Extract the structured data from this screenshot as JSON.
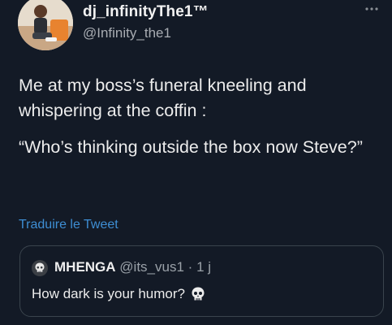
{
  "author": {
    "display_name": "dj_infinityThe1™",
    "handle": "@Infinity_the1"
  },
  "tweet": {
    "paragraphs": [
      "Me at my boss’s funeral kneeling and whispering at the coffin :",
      "“Who’s thinking outside the box now Steve?”"
    ],
    "translate_label": "Traduire le Tweet"
  },
  "quote": {
    "name": "MHENGA",
    "handle": "@its_vus1",
    "separator": "·",
    "time": "1 j",
    "text": "How dark is your humor?",
    "text_icon": "skull-icon",
    "avatar_icon": "skull-avatar-icon"
  },
  "icons": {
    "menu": "more-horizontal-icon"
  },
  "colors": {
    "background": "#131a26",
    "link": "#3e8ed3",
    "border": "#3a444d",
    "muted": "#a8acb2"
  }
}
